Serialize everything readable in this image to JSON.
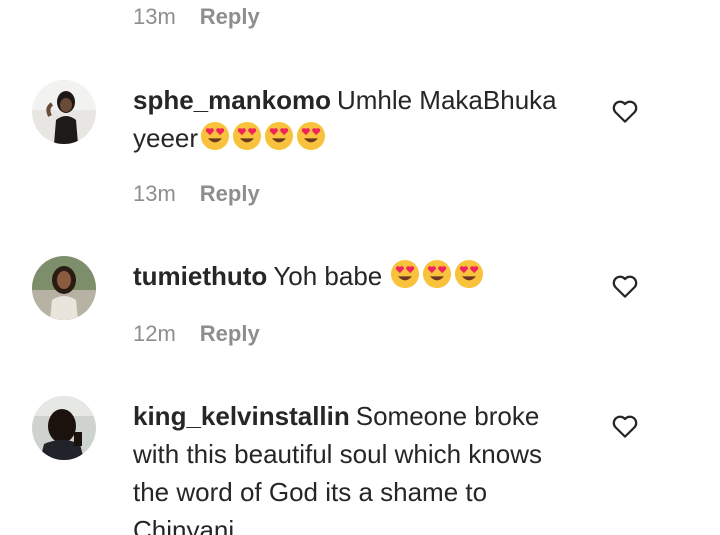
{
  "top_meta": {
    "time": "13m",
    "reply": "Reply"
  },
  "comments": [
    {
      "username": "sphe_mankomo",
      "text_line1": "Umhle MakaBhuka",
      "text_line2": "yeeer",
      "emoji_count": 4,
      "time": "13m",
      "reply": "Reply"
    },
    {
      "username": "tumiethuto",
      "text": "Yoh babe",
      "emoji_count": 3,
      "time": "12m",
      "reply": "Reply"
    },
    {
      "username": "king_kelvinstallin",
      "text": "Someone broke with this beautiful soul which knows the word of God its a shame to Chinyani"
    }
  ],
  "icons": {
    "like": "heart-outline-icon",
    "emoji": "smiling-face-with-heart-eyes-icon"
  },
  "colors": {
    "text": "#262626",
    "secondary": "#8e8e8e",
    "emoji_face": "#f9c23c",
    "emoji_heart": "#f0245c"
  }
}
